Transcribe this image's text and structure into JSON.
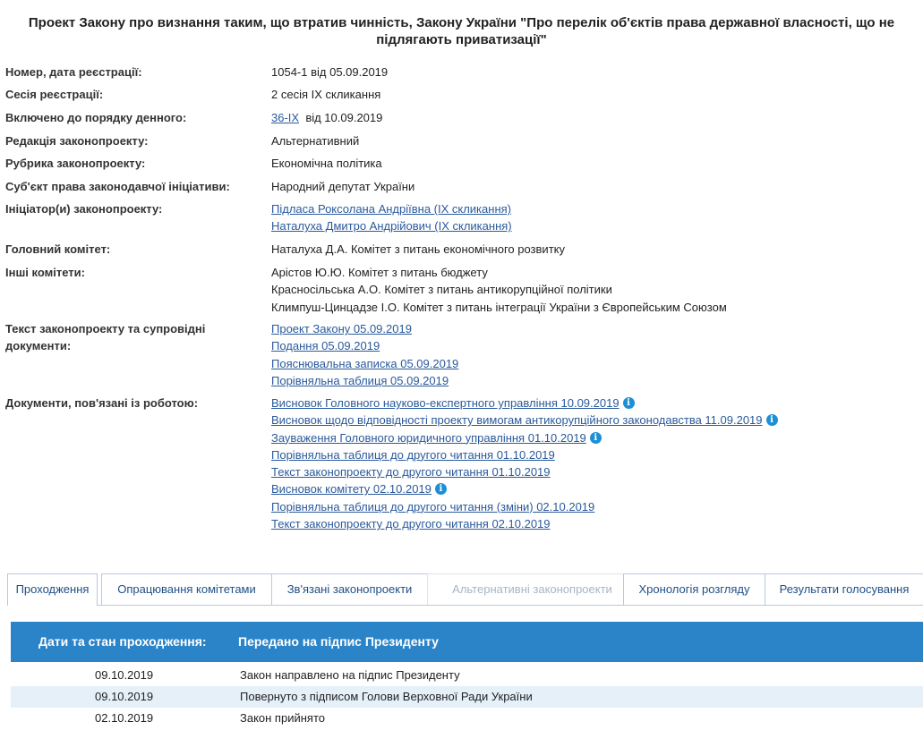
{
  "title": "Проект Закону про визнання таким, що втратив чинність, Закону України \"Про перелік об'єктів права державної власності, що не підлягають приватизації\"",
  "fields": {
    "reg": {
      "label": "Номер, дата реєстрації:",
      "value": "1054-1 від 05.09.2019"
    },
    "session": {
      "label": "Сесія реєстрації:",
      "value": "2 сесія IX скликання"
    },
    "agenda": {
      "label": "Включено до порядку денного:",
      "link": "36-IX",
      "value": "від 10.09.2019"
    },
    "edition": {
      "label": "Редакція законопроекту:",
      "value": "Альтернативний"
    },
    "rubric": {
      "label": "Рубрика законопроекту:",
      "value": "Економічна політика"
    },
    "subject": {
      "label": "Суб'єкт права законодавчої ініціативи:",
      "value": "Народний депутат України"
    },
    "initiators": {
      "label": "Ініціатор(и) законопроекту:",
      "items": [
        "Підласа Роксолана Андріївна (IX скликання)",
        "Наталуха Дмитро Андрійович (IX скликання)"
      ]
    },
    "main_committee": {
      "label": "Головний комітет:",
      "value": "Наталуха Д.А. Комітет з питань економічного розвитку"
    },
    "other_committees": {
      "label": "Інші комітети:",
      "items": [
        "Арістов Ю.Ю. Комітет з питань бюджету",
        "Красносільська А.О. Комітет з питань антикорупційної політики",
        "Климпуш-Цинцадзе І.О. Комітет з питань інтеграції України з Європейським Союзом"
      ]
    },
    "texts": {
      "label": "Текст законопроекту та супровідні документи:",
      "items": [
        "Проект Закону 05.09.2019",
        "Подання 05.09.2019",
        "Пояснювальна записка 05.09.2019",
        "Порівняльна таблиця 05.09.2019"
      ]
    },
    "documents": {
      "label": "Документи, пов'язані із роботою:",
      "items": [
        {
          "text": "Висновок Головного науково-експертного управління 10.09.2019",
          "info": true
        },
        {
          "text": "Висновок щодо відповідності проекту вимогам антикорупційного законодавства 11.09.2019",
          "info": true
        },
        {
          "text": "Зауваження Головного юридичного управління 01.10.2019",
          "info": true
        },
        {
          "text": "Порівняльна таблиця до другого читання 01.10.2019",
          "info": false
        },
        {
          "text": "Текст законопроекту до другого читання 01.10.2019",
          "info": false
        },
        {
          "text": "Висновок комітету 02.10.2019",
          "info": true
        },
        {
          "text": "Порівняльна таблиця до другого читання (зміни) 02.10.2019",
          "info": false
        },
        {
          "text": "Текст законопроекту до другого читання 02.10.2019",
          "info": false
        }
      ]
    }
  },
  "info_glyph": "i",
  "tabs": [
    "Проходження",
    "Опрацювання комітетами",
    "Зв'язані законопроекти",
    "Альтернативні законопроекти",
    "Хронологія розгляду",
    "Результати голосування"
  ],
  "table": {
    "header_label": "Дати та стан проходження:",
    "header_status": "Передано на підпис Президенту",
    "rows": [
      {
        "date": "09.10.2019",
        "status": "Закон направлено на підпис Президенту"
      },
      {
        "date": "09.10.2019",
        "status": "Повернуто з підписом Голови Верховної Ради України"
      },
      {
        "date": "02.10.2019",
        "status": "Закон прийнято"
      }
    ]
  }
}
